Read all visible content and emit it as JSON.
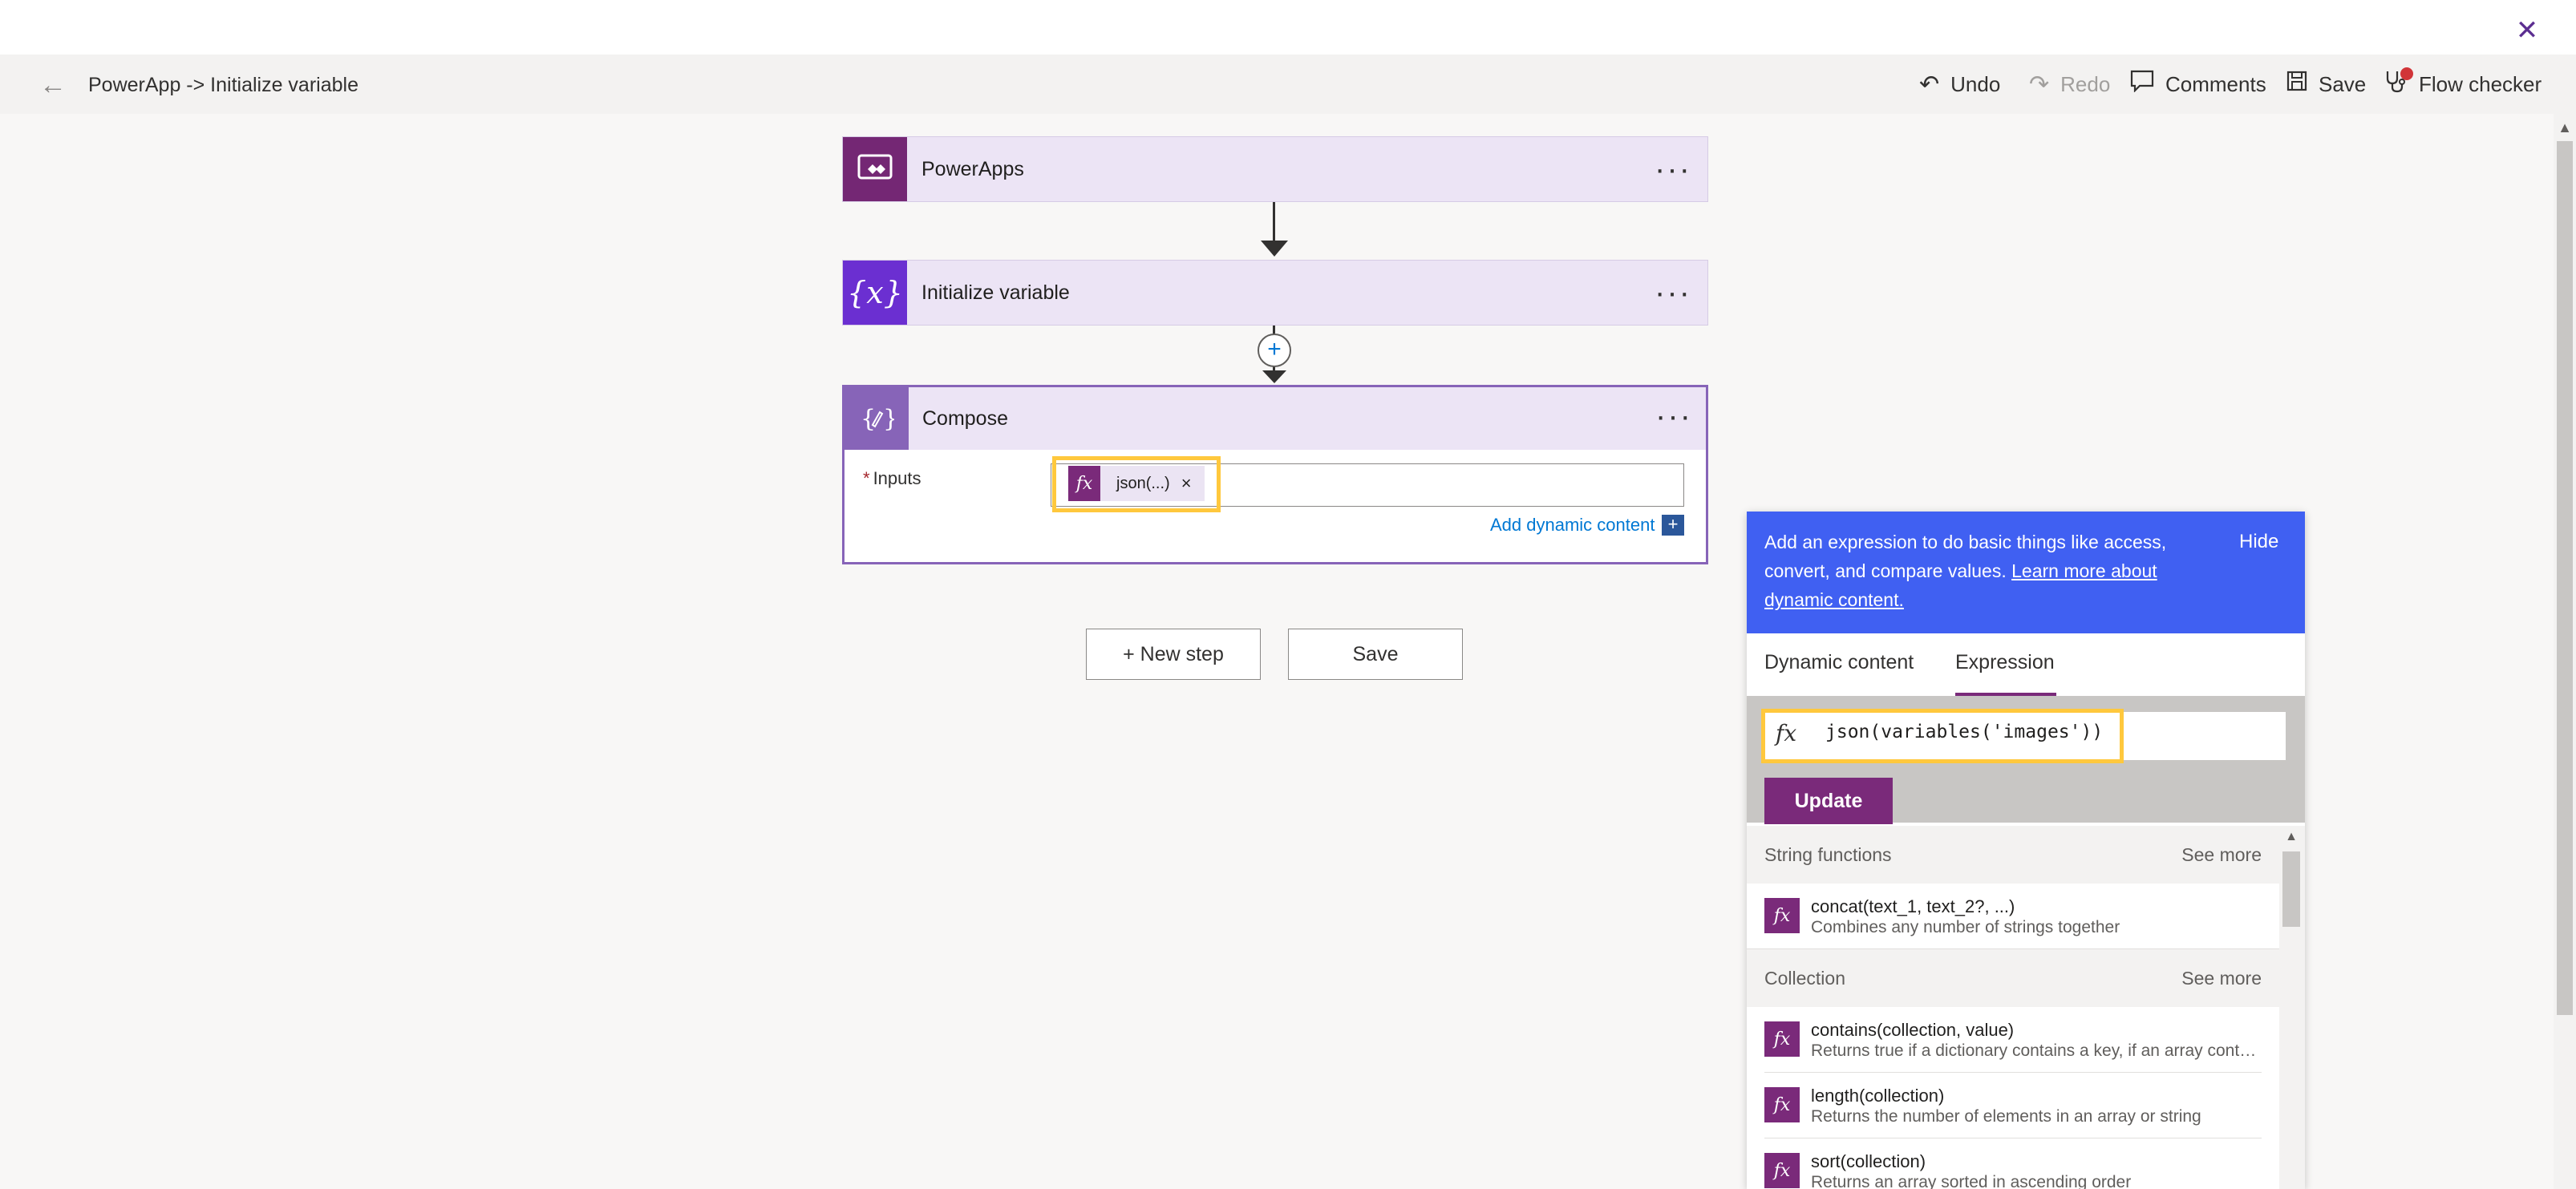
{
  "window": {
    "close_icon": "close-icon"
  },
  "header": {
    "breadcrumb": "PowerApp -> Initialize variable",
    "undo": "Undo",
    "redo": "Redo",
    "comments": "Comments",
    "save": "Save",
    "flow_checker": "Flow checker"
  },
  "flow": {
    "steps": [
      {
        "title": "PowerApps",
        "icon": "powerapps-icon"
      },
      {
        "title": "Initialize variable",
        "icon": "variable-icon"
      }
    ],
    "compose": {
      "title": "Compose",
      "inputs_label": "Inputs",
      "required_mark": "*",
      "token_label": "json(...)",
      "token_remove": "×",
      "add_dynamic": "Add dynamic content",
      "add_dynamic_icon": "+"
    },
    "more_glyph": "···",
    "new_step": "+ New step",
    "save": "Save"
  },
  "panel": {
    "info_text": "Add an expression to do basic things like access, convert, and compare values.",
    "info_link": "Learn more about dynamic content.",
    "hide": "Hide",
    "tabs": [
      "Dynamic content",
      "Expression"
    ],
    "active_tab": "Expression",
    "expression": "json(variables('images'))",
    "update": "Update",
    "sections": [
      {
        "title": "String functions",
        "see_more": "See more",
        "items": [
          {
            "name": "concat(text_1, text_2?, ...)",
            "desc": "Combines any number of strings together"
          }
        ]
      },
      {
        "title": "Collection",
        "see_more": "See more",
        "items": [
          {
            "name": "contains(collection, value)",
            "desc": "Returns true if a dictionary contains a key, if an array contains a value, or if a string contains a substring"
          },
          {
            "name": "length(collection)",
            "desc": "Returns the number of elements in an array or string"
          },
          {
            "name": "sort(collection)",
            "desc": "Returns an array sorted in ascending order"
          }
        ]
      }
    ]
  },
  "colors": {
    "accent": "#7a2a7a",
    "card_bg": "#ece4f5",
    "info_bg": "#4060f2",
    "highlight": "#ffc83d",
    "link": "#0078d4"
  }
}
